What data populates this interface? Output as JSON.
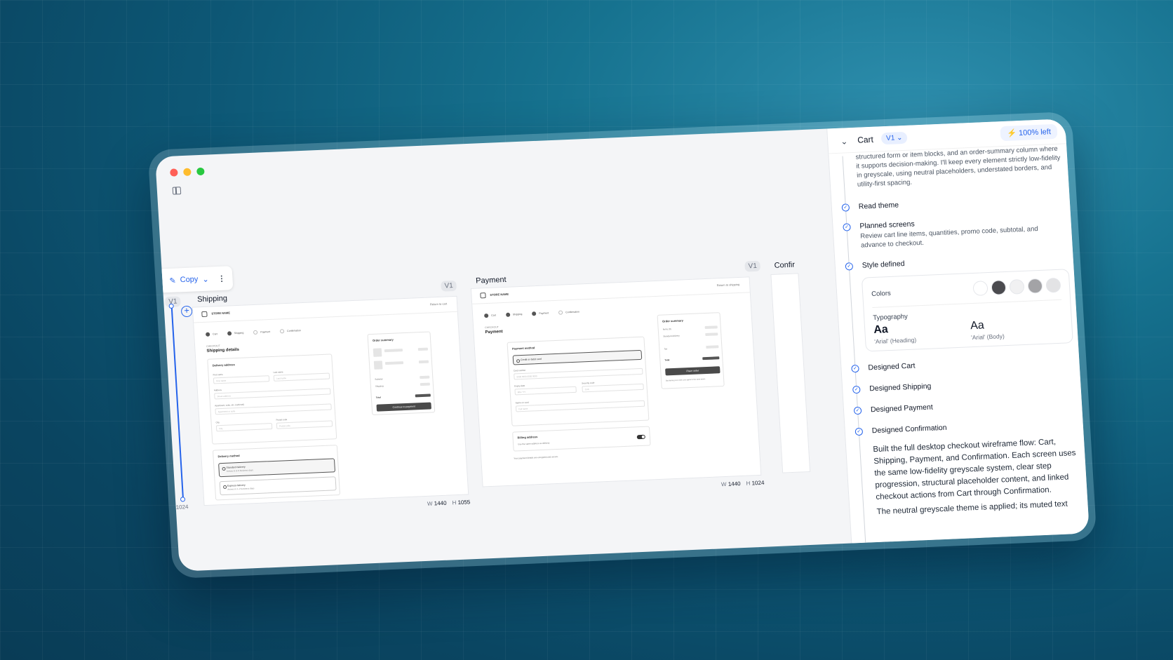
{
  "window": {
    "controls": [
      "close",
      "minimize",
      "maximize"
    ]
  },
  "toolbar": {
    "copy_label": "Copy"
  },
  "frames": [
    {
      "name": "Shipping",
      "version": "V1",
      "width": "1440",
      "height": "1055",
      "w_label": "W",
      "h_label": "H"
    },
    {
      "name": "Payment",
      "version": "V1",
      "width": "1440",
      "height": "1024",
      "w_label": "W",
      "h_label": "H"
    },
    {
      "name": "Confir"
    }
  ],
  "left_frame": {
    "version": "V1",
    "height_fragment": "1024"
  },
  "shipping_wf": {
    "store": "STORE NAME",
    "return": "Return to cart",
    "steps": [
      "Cart",
      "Shipping",
      "Payment",
      "Confirmation"
    ],
    "kicker": "CHECKOUT",
    "title": "Shipping details",
    "delivery_address": "Delivery address",
    "first_name": "First name",
    "first_ph": "First name",
    "last_name": "Last name",
    "last_ph": "Last name",
    "address": "Address",
    "address_ph": "Street address",
    "apt": "Apartment, suite, etc. (optional)",
    "apt_ph": "Apartment or suite",
    "city": "City",
    "city_ph": "City",
    "postal": "Postal code",
    "postal_ph": "Postal code",
    "delivery_method": "Delivery method",
    "standard": "Standard delivery",
    "standard_sub": "Arrives in 3–5 business days",
    "express": "Express delivery",
    "express_sub": "Arrives in 1–2 business days",
    "order_summary": "Order summary",
    "subtotal": "Subtotal",
    "shipping": "Shipping",
    "total": "Total",
    "cta": "Continue to payment"
  },
  "payment_wf": {
    "store": "STORE NAME",
    "return": "Return to shipping",
    "steps": [
      "Cart",
      "Shipping",
      "Payment",
      "Confirmation"
    ],
    "kicker": "CHECKOUT",
    "title": "Payment",
    "payment_method": "Payment method",
    "card_option": "Credit or debit card",
    "card_number": "Card number",
    "card_ph": "0000 0000 0000 0000",
    "expiry": "Expiry date",
    "expiry_ph": "MM / YY",
    "security": "Security code",
    "security_ph": "CVC",
    "name": "Name on card",
    "name_ph": "Full name",
    "billing": "Billing address",
    "billing_sub": "Use the same address as delivery",
    "note": "Your payment details are encrypted and secure.",
    "order_summary": "Order summary",
    "items": "Items (3)",
    "standard_delivery": "Standard delivery",
    "tax": "Tax",
    "total": "Total",
    "cta": "Place order",
    "terms": "By placing your order, you agree to the store terms."
  },
  "panel": {
    "title": "Cart",
    "version": "V1",
    "credits": "100% left",
    "intro": "structured form or item blocks, and an order-summary column where it supports decision-making. I'll keep every element strictly low-fidelity in greyscale, using neutral placeholders, understated borders, and utility-first spacing.",
    "steps": [
      {
        "title": "Read theme"
      },
      {
        "title": "Planned screens",
        "desc": "Review cart line items, quantities, promo code, subtotal, and advance to checkout."
      },
      {
        "title": "Style defined"
      },
      {
        "title": "Designed Cart"
      },
      {
        "title": "Designed Shipping"
      },
      {
        "title": "Designed Payment"
      },
      {
        "title": "Designed Confirmation"
      }
    ],
    "style": {
      "colors_label": "Colors",
      "swatches": [
        "#ffffff",
        "#4b4b4f",
        "#f1f1f2",
        "#a3a3a6",
        "#e3e3e5"
      ],
      "typography_label": "Typography",
      "heading_sample": "Aa",
      "heading_font": "'Arial' (Heading)",
      "body_sample": "Aa",
      "body_font": "'Arial' (Body)"
    },
    "summary_p1": "Built the full desktop checkout wireframe flow: Cart, Shipping, Payment, and Confirmation. Each screen uses the same low-fidelity greyscale system, clear step progression, structural placeholder content, and linked checkout actions from Cart through Confirmation.",
    "summary_p2": "The neutral greyscale theme is applied; its muted text"
  }
}
